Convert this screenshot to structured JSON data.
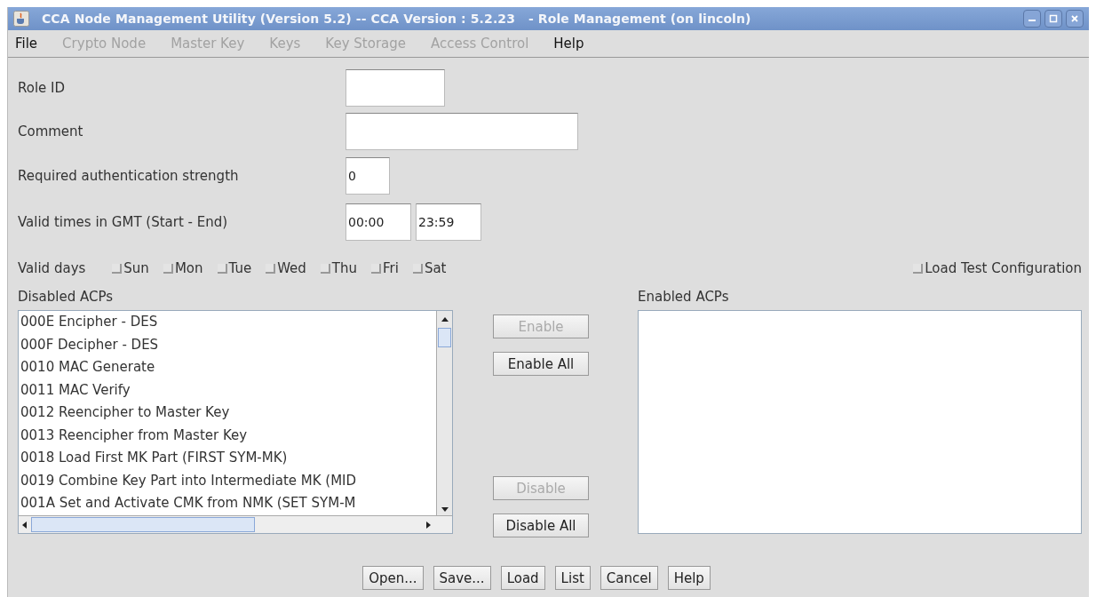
{
  "window": {
    "title": "CCA Node Management Utility (Version 5.2) -- CCA Version : 5.2.23   - Role Management (on lincoln)"
  },
  "menu": [
    {
      "label": "File",
      "disabled": false
    },
    {
      "label": "Crypto Node",
      "disabled": true
    },
    {
      "label": "Master Key",
      "disabled": true
    },
    {
      "label": "Keys",
      "disabled": true
    },
    {
      "label": "Key Storage",
      "disabled": true
    },
    {
      "label": "Access Control",
      "disabled": true
    },
    {
      "label": "Help",
      "disabled": false
    }
  ],
  "fields": [
    {
      "label": "Role ID"
    },
    {
      "label": "Comment"
    },
    {
      "label": "Required authentication strength",
      "values": [
        "0"
      ]
    },
    {
      "label": "Valid times in GMT (Start - End)",
      "values": [
        "00:00",
        "23:59"
      ]
    }
  ],
  "valid_days": {
    "label": "Valid days",
    "days": [
      {
        "label": "Sun",
        "checked": false
      },
      {
        "label": "Mon",
        "checked": false
      },
      {
        "label": "Tue",
        "checked": false
      },
      {
        "label": "Wed",
        "checked": false
      },
      {
        "label": "Thu",
        "checked": false
      },
      {
        "label": "Fri",
        "checked": false
      },
      {
        "label": "Sat",
        "checked": false
      }
    ]
  },
  "load_test_configuration": {
    "label": "Load Test Configuration",
    "checked": false
  },
  "disabled_acps": {
    "label": "Disabled ACPs",
    "items": [
      "000E Encipher - DES",
      "000F Decipher - DES",
      "0010 MAC Generate",
      "0011 MAC Verify",
      "0012 Reencipher to Master Key",
      "0013 Reencipher from Master Key",
      "0018 Load First MK Part (FIRST SYM-MK)",
      "0019 Combine Key Part into Intermediate MK (MID",
      "001A Set and Activate CMK from NMK (SET SYM-M"
    ]
  },
  "transfer_buttons": [
    {
      "label": "Enable",
      "disabled": true
    },
    {
      "label": "Enable All",
      "disabled": false
    },
    {
      "label": "Disable",
      "disabled": true
    },
    {
      "label": "Disable All",
      "disabled": false
    }
  ],
  "enabled_acps": {
    "label": "Enabled ACPs"
  },
  "buttons": [
    "Open...",
    "Save...",
    "Load",
    "List",
    "Cancel",
    "Help"
  ]
}
